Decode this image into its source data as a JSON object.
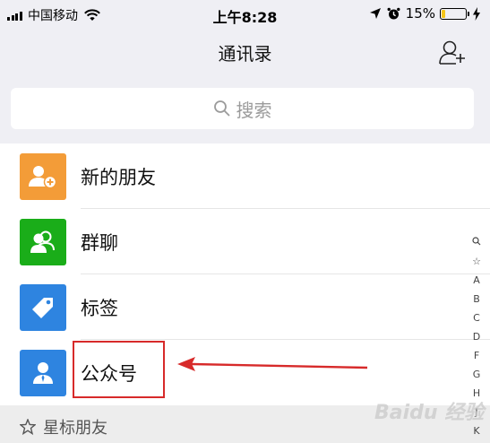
{
  "status_bar": {
    "carrier": "中国移动",
    "time": "上午8:28",
    "battery": "15%",
    "battery_level": 0.15
  },
  "nav": {
    "title": "通讯录"
  },
  "search": {
    "placeholder": "搜索"
  },
  "contacts_menu": [
    {
      "label": "新的朋友",
      "icon": "new-friend-icon",
      "color": "#f39c38"
    },
    {
      "label": "群聊",
      "icon": "group-chat-icon",
      "color": "#1aad19"
    },
    {
      "label": "标签",
      "icon": "tag-icon",
      "color": "#2e84e0"
    },
    {
      "label": "公众号",
      "icon": "official-account-icon",
      "color": "#2e84e0"
    }
  ],
  "section": {
    "label": "星标朋友"
  },
  "index_letters": [
    "☆",
    "A",
    "B",
    "C",
    "D",
    "F",
    "G",
    "H",
    "J",
    "K"
  ],
  "watermark": "Baidu 经验",
  "annotation": {
    "color": "#d72a2a"
  }
}
